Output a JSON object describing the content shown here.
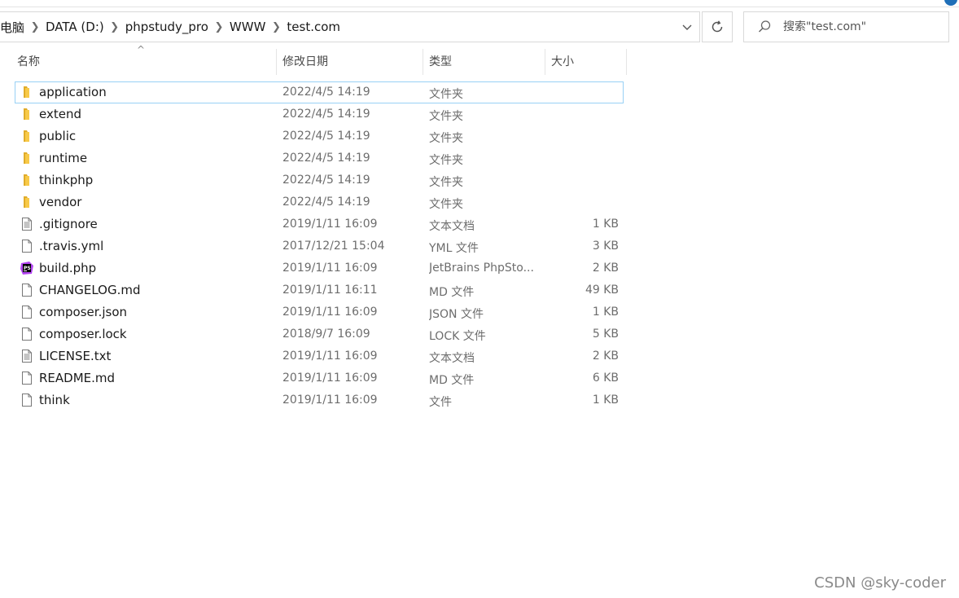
{
  "address": {
    "breadcrumbs": [
      "电脑",
      "DATA (D:)",
      "phpstudy_pro",
      "WWW",
      "test.com"
    ]
  },
  "search": {
    "placeholder": "搜索\"test.com\""
  },
  "columns": {
    "name": "名称",
    "date": "修改日期",
    "type": "类型",
    "size": "大小"
  },
  "files": [
    {
      "name": "application",
      "date": "2022/4/5 14:19",
      "type": "文件夹",
      "size": "",
      "icon": "folder-icon",
      "selected": true
    },
    {
      "name": "extend",
      "date": "2022/4/5 14:19",
      "type": "文件夹",
      "size": "",
      "icon": "folder-icon"
    },
    {
      "name": "public",
      "date": "2022/4/5 14:19",
      "type": "文件夹",
      "size": "",
      "icon": "folder-icon"
    },
    {
      "name": "runtime",
      "date": "2022/4/5 14:19",
      "type": "文件夹",
      "size": "",
      "icon": "folder-icon"
    },
    {
      "name": "thinkphp",
      "date": "2022/4/5 14:19",
      "type": "文件夹",
      "size": "",
      "icon": "folder-icon"
    },
    {
      "name": "vendor",
      "date": "2022/4/5 14:19",
      "type": "文件夹",
      "size": "",
      "icon": "folder-icon"
    },
    {
      "name": ".gitignore",
      "date": "2019/1/11 16:09",
      "type": "文本文档",
      "size": "1 KB",
      "icon": "text-document-icon"
    },
    {
      "name": ".travis.yml",
      "date": "2017/12/21 15:04",
      "type": "YML 文件",
      "size": "3 KB",
      "icon": "blank-file-icon"
    },
    {
      "name": "build.php",
      "date": "2019/1/11 16:09",
      "type": "JetBrains PhpSto...",
      "size": "2 KB",
      "icon": "phpstorm-icon"
    },
    {
      "name": "CHANGELOG.md",
      "date": "2019/1/11 16:11",
      "type": "MD 文件",
      "size": "49 KB",
      "icon": "blank-file-icon"
    },
    {
      "name": "composer.json",
      "date": "2019/1/11 16:09",
      "type": "JSON 文件",
      "size": "1 KB",
      "icon": "blank-file-icon"
    },
    {
      "name": "composer.lock",
      "date": "2018/9/7 16:09",
      "type": "LOCK 文件",
      "size": "5 KB",
      "icon": "blank-file-icon"
    },
    {
      "name": "LICENSE.txt",
      "date": "2019/1/11 16:09",
      "type": "文本文档",
      "size": "2 KB",
      "icon": "text-document-icon"
    },
    {
      "name": "README.md",
      "date": "2019/1/11 16:09",
      "type": "MD 文件",
      "size": "6 KB",
      "icon": "blank-file-icon"
    },
    {
      "name": "think",
      "date": "2019/1/11 16:09",
      "type": "文件",
      "size": "1 KB",
      "icon": "blank-file-icon"
    }
  ],
  "colors": {
    "selection_border": "#99d1f5",
    "folder": "#f7c948",
    "phpstorm": "#b345f1"
  },
  "watermark": "CSDN @sky-coder"
}
